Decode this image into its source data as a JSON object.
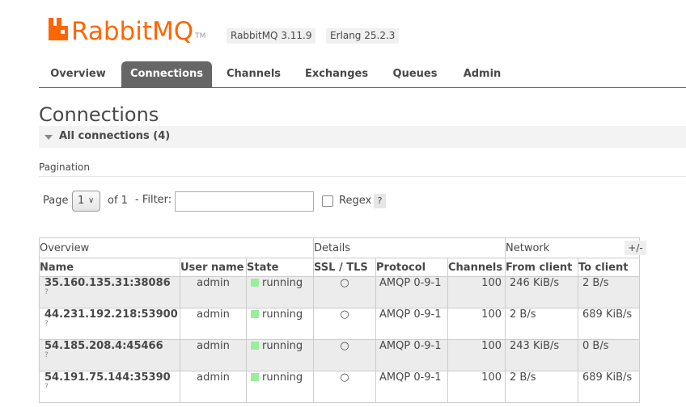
{
  "header": {
    "logo_text_main": "Rabbit",
    "logo_text_mq": "MQ",
    "logo_tm": "TM",
    "version_rabbit": "RabbitMQ 3.11.9",
    "version_erlang": "Erlang 25.2.3",
    "brand_color": "#ff6600"
  },
  "tabs": [
    {
      "label": "Overview",
      "active": false
    },
    {
      "label": "Connections",
      "active": true
    },
    {
      "label": "Channels",
      "active": false
    },
    {
      "label": "Exchanges",
      "active": false
    },
    {
      "label": "Queues",
      "active": false
    },
    {
      "label": "Admin",
      "active": false
    }
  ],
  "page_title": "Connections",
  "section": {
    "label": "All connections (4)"
  },
  "pagination": {
    "label": "Pagination",
    "page_label": "Page",
    "page_value": "1",
    "of_label": "of 1",
    "filter_label": "- Filter:",
    "filter_value": "",
    "regex_label": "Regex",
    "help": "?"
  },
  "table": {
    "groups": [
      "Overview",
      "Details",
      "Network"
    ],
    "columns": [
      "Name",
      "User name",
      "State",
      "SSL / TLS",
      "Protocol",
      "Channels",
      "From client",
      "To client"
    ],
    "plus_minus": "+/-",
    "rows": [
      {
        "name": "35.160.135.31:38086",
        "q": "?",
        "user": "admin",
        "state": "running",
        "ssl": "○",
        "protocol": "AMQP 0-9-1",
        "channels": "100",
        "from_client": "246 KiB/s",
        "to_client": "2 B/s"
      },
      {
        "name": "44.231.192.218:53900",
        "q": "?",
        "user": "admin",
        "state": "running",
        "ssl": "○",
        "protocol": "AMQP 0-9-1",
        "channels": "100",
        "from_client": "2 B/s",
        "to_client": "689 KiB/s"
      },
      {
        "name": "54.185.208.4:45466",
        "q": "?",
        "user": "admin",
        "state": "running",
        "ssl": "○",
        "protocol": "AMQP 0-9-1",
        "channels": "100",
        "from_client": "243 KiB/s",
        "to_client": "0 B/s"
      },
      {
        "name": "54.191.75.144:35390",
        "q": "?",
        "user": "admin",
        "state": "running",
        "ssl": "○",
        "protocol": "AMQP 0-9-1",
        "channels": "100",
        "from_client": "2 B/s",
        "to_client": "689 KiB/s"
      }
    ]
  }
}
